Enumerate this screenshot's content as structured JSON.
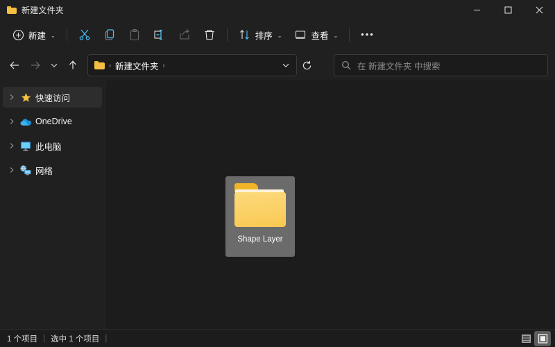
{
  "window": {
    "title": "新建文件夹",
    "title_icon": "folder-icon",
    "controls": {
      "minimize": "—",
      "maximize": "□",
      "close": "✕"
    }
  },
  "toolbar": {
    "new_label": "新建",
    "new_icon": "plus-circle-icon",
    "cut_icon": "scissors-icon",
    "copy_icon": "copy-icon",
    "paste_icon": "paste-icon",
    "rename_icon": "rename-icon",
    "share_icon": "share-icon",
    "delete_icon": "trash-icon",
    "sort_label": "排序",
    "sort_icon": "sort-arrows-icon",
    "view_label": "查看",
    "view_icon": "monitor-icon",
    "more_label": "•••",
    "chevron": "⌄"
  },
  "navigation": {
    "back_icon": "arrow-left-icon",
    "forward_icon": "arrow-right-icon",
    "recent_icon": "chevron-down-icon",
    "up_icon": "arrow-up-icon",
    "refresh_icon": "refresh-icon"
  },
  "address": {
    "folder_icon": "folder-icon",
    "separator": "›",
    "crumb": "新建文件夹",
    "trailing_separator": "›",
    "dropdown": "⌄"
  },
  "search": {
    "icon": "search-icon",
    "placeholder": "在 新建文件夹 中搜索"
  },
  "sidebar": {
    "items": [
      {
        "label": "快速访问",
        "icon": "star-icon",
        "expander": "›",
        "selected": true
      },
      {
        "label": "OneDrive",
        "icon": "cloud-icon",
        "expander": "›",
        "selected": false
      },
      {
        "label": "此电脑",
        "icon": "monitor-icon",
        "expander": "›",
        "selected": false
      },
      {
        "label": "网络",
        "icon": "network-icon",
        "expander": "›",
        "selected": false
      }
    ]
  },
  "content": {
    "files": [
      {
        "name": "Shape Layer",
        "type": "folder",
        "selected": true
      }
    ]
  },
  "status": {
    "item_count": "1 个项目",
    "separator1": "|",
    "selected_count": "选中 1 个项目",
    "separator2": "|",
    "view_list_icon": "list-view-icon",
    "view_icons_icon": "large-icons-view-icon"
  },
  "colors": {
    "accent": "#4cc2ff",
    "folder_front": "#fbd064",
    "folder_back": "#f0b429",
    "star": "#f5c242",
    "window_bg": "#202020",
    "content_bg": "#1c1c1c",
    "selection": "#6b6b6b"
  }
}
